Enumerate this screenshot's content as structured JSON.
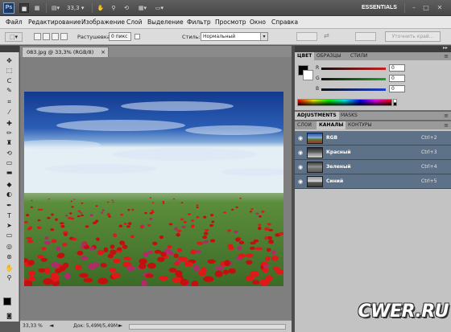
{
  "app_bar": {
    "logo": "Ps",
    "zoom_value": "33,3",
    "workspace": "ESSENTIALS",
    "icons": [
      "br-icon",
      "mini-bridge-icon",
      "arrange-icon",
      "zoom-level-icon",
      "hand-icon",
      "zoom-icon",
      "rotate-view-icon",
      "grid-icon",
      "screen-mode-icon",
      "minimize-icon",
      "maximize-icon",
      "close-icon"
    ],
    "minimize": "–",
    "maximize": "□",
    "close": "✕"
  },
  "menu": {
    "items": [
      "Файл",
      "Редактирование",
      "Изображение",
      "Слой",
      "Выделение",
      "Фильтр",
      "Просмотр",
      "Окно",
      "Справка"
    ]
  },
  "options": {
    "feather_label": "Растушевка:",
    "feather_value": "0 пикс",
    "style_label": "Стиль:",
    "style_value": "Нормальный",
    "refine_button": "Уточнить край..."
  },
  "tools": {
    "items": [
      "move-tool-icon",
      "marquee-tool-icon",
      "lasso-tool-icon",
      "quick-select-tool-icon",
      "crop-tool-icon",
      "eyedropper-tool-icon",
      "healing-brush-tool-icon",
      "brush-tool-icon",
      "clone-stamp-tool-icon",
      "history-brush-tool-icon",
      "eraser-tool-icon",
      "gradient-tool-icon",
      "blur-tool-icon",
      "dodge-tool-icon",
      "pen-tool-icon",
      "type-tool-icon",
      "path-select-tool-icon",
      "shape-tool-icon",
      "3d-rotate-tool-icon",
      "3d-orbit-tool-icon",
      "hand-tool-icon",
      "zoom-tool-icon"
    ],
    "glyphs": [
      "✥",
      "⬚",
      "ᑕ",
      "✎",
      "⌗",
      "⁄",
      "✚",
      "✏",
      "♜",
      "⟲",
      "▭",
      "▬",
      "◆",
      "◐",
      "✒",
      "T",
      "➤",
      "▭",
      "◎",
      "⊛",
      "✋",
      "⚲"
    ]
  },
  "document": {
    "tab_title": "083.jpg @ 33,3% (RGB/8)",
    "tab_close": "×",
    "status_zoom": "33,33 %",
    "status_doc": "Док: 5,49M/5,49M"
  },
  "color_panel": {
    "tabs": [
      "ЦВЕТ",
      "ОБРАЗЦЫ",
      "СТИЛИ"
    ],
    "sliders": [
      {
        "label": "R",
        "value": "0",
        "color": "#c81e1e"
      },
      {
        "label": "G",
        "value": "0",
        "color": "#1ea01e"
      },
      {
        "label": "B",
        "value": "0",
        "color": "#1e3ec8"
      }
    ]
  },
  "adjustments_panel": {
    "tabs": [
      "ADJUSTMENTS",
      "MASKS"
    ]
  },
  "layers_panel": {
    "tabs": [
      "СЛОИ",
      "КАНАЛЫ",
      "КОНТУРЫ"
    ],
    "channels": [
      {
        "name": "RGB",
        "shortcut": "Ctrl+2"
      },
      {
        "name": "Красный",
        "shortcut": "Ctrl+3"
      },
      {
        "name": "Зеленый",
        "shortcut": "Ctrl+4"
      },
      {
        "name": "Синий",
        "shortcut": "Ctrl+5"
      }
    ]
  },
  "watermark": "CWER.RU",
  "colors": {
    "channel_highlight": "#5d7188",
    "app_bar": "#4f4f4f"
  }
}
